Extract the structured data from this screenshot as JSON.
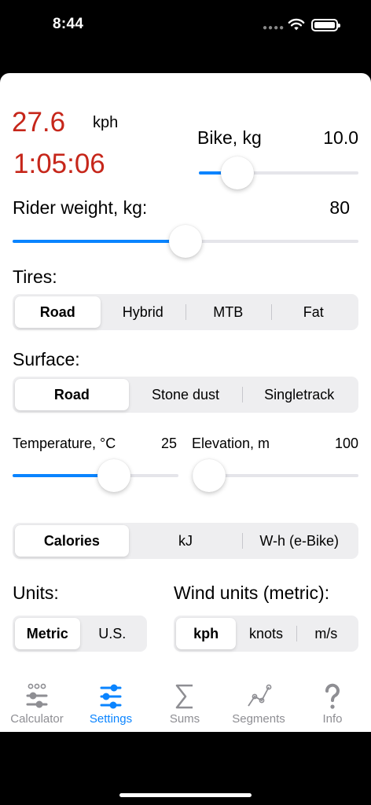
{
  "status": {
    "time": "8:44"
  },
  "speed": {
    "value": "27.6",
    "unit": "kph"
  },
  "time_result": "1:05:06",
  "bike": {
    "label": "Bike, kg",
    "value": "10.0",
    "level": 0.24
  },
  "rider": {
    "label": "Rider weight, kg:",
    "value": "80",
    "level": 0.5
  },
  "tires": {
    "label": "Tires:",
    "options": [
      "Road",
      "Hybrid",
      "MTB",
      "Fat"
    ],
    "selected": 0
  },
  "surface": {
    "label": "Surface:",
    "options": [
      "Road",
      "Stone dust",
      "Singletrack"
    ],
    "selected": 0
  },
  "temperature": {
    "label": "Temperature, °C",
    "value": "25",
    "level": 0.61
  },
  "elevation": {
    "label": "Elevation, m",
    "value": "100",
    "level": 0.1
  },
  "energy": {
    "options": [
      "Calories",
      "kJ",
      "W-h (e-Bike)"
    ],
    "selected": 0
  },
  "units": {
    "label": "Units:",
    "options": [
      "Metric",
      "U.S."
    ],
    "selected": 0
  },
  "wind_units": {
    "label": "Wind units (metric):",
    "options": [
      "kph",
      "knots",
      "m/s"
    ],
    "selected": 0
  },
  "tabbar": {
    "tabs": [
      {
        "label": "Calculator",
        "icon": "calculator-icon"
      },
      {
        "label": "Settings",
        "icon": "settings-sliders-icon"
      },
      {
        "label": "Sums",
        "icon": "sigma-icon"
      },
      {
        "label": "Segments",
        "icon": "segments-graph-icon"
      },
      {
        "label": "Info",
        "icon": "question-icon"
      }
    ],
    "active": 1
  },
  "colors": {
    "accent": "#0a84ff",
    "result_red": "#c6261a",
    "inactive_gray": "#8e8e93"
  }
}
